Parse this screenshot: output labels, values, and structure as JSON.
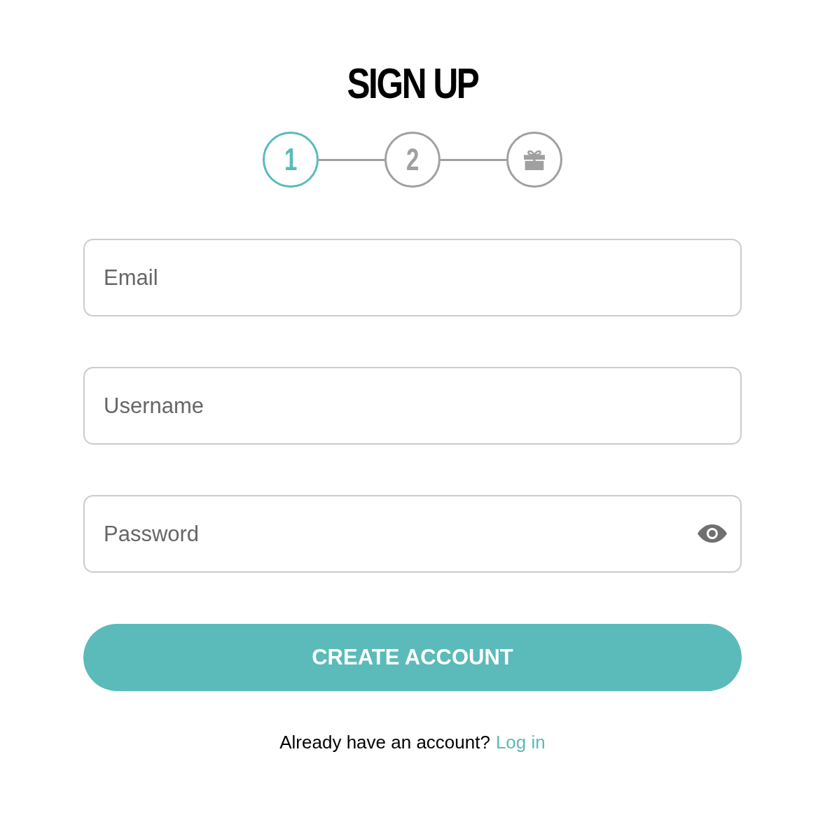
{
  "title": "SIGN UP",
  "steps": [
    {
      "kind": "number",
      "label": "1",
      "selected": true
    },
    {
      "kind": "number",
      "label": "2",
      "selected": false
    },
    {
      "kind": "gift",
      "selected": false
    }
  ],
  "fields": [
    {
      "kind": "text",
      "placeholder": "Email"
    },
    {
      "kind": "text",
      "placeholder": "Username"
    },
    {
      "kind": "password",
      "placeholder": "Password"
    }
  ],
  "button": {
    "label": "CREATE ACCOUNT"
  },
  "footer": {
    "text": "Already have an account?",
    "link": "Log in"
  }
}
